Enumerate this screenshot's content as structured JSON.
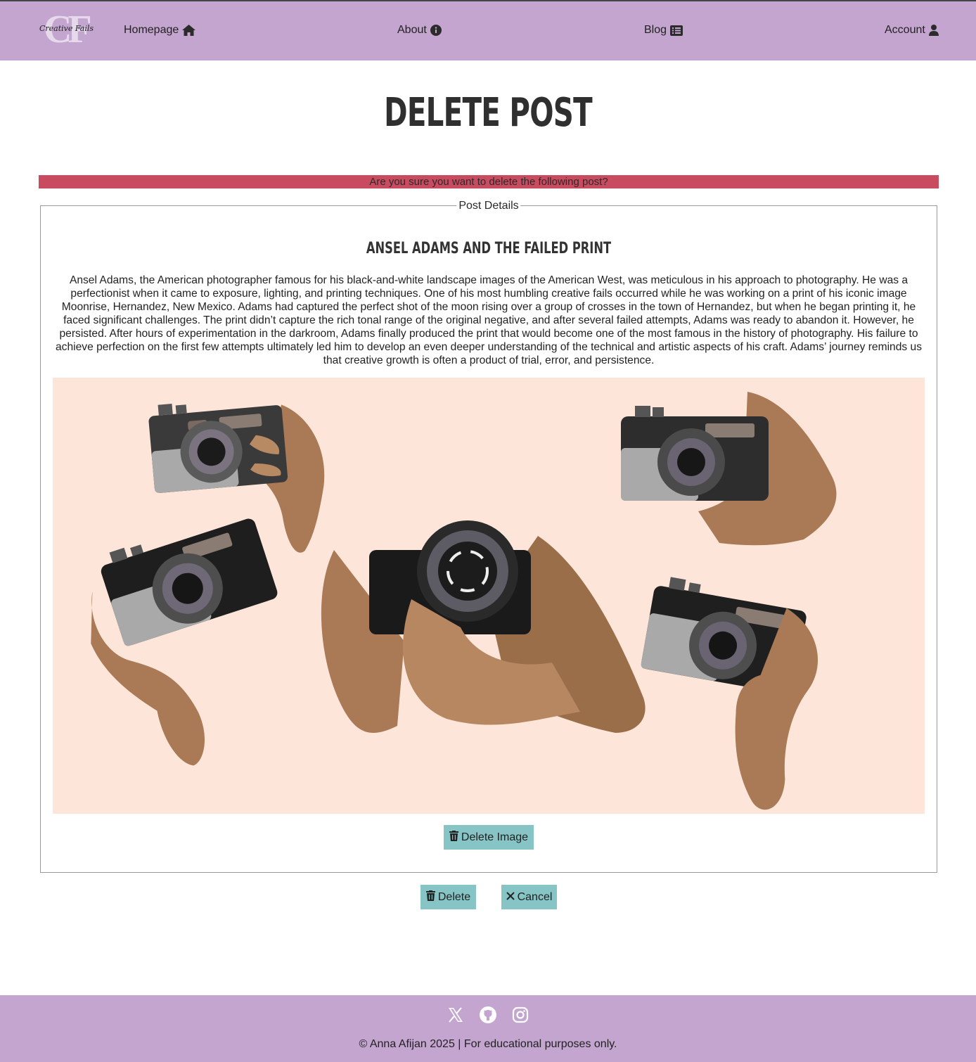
{
  "nav": {
    "logo_monogram": "CF",
    "logo_script": "Creative Fails",
    "links": [
      {
        "label": "Homepage",
        "icon": "home-icon"
      },
      {
        "label": "About",
        "icon": "info-circle-icon"
      },
      {
        "label": "Blog",
        "icon": "list-alt-icon"
      },
      {
        "label": "Account",
        "icon": "user-icon"
      }
    ]
  },
  "page": {
    "title": "DELETE POST",
    "warning": "Are you sure you want to delete the following post?"
  },
  "post": {
    "legend": "Post Details",
    "title": "ANSEL ADAMS AND THE FAILED PRINT",
    "body": "Ansel Adams, the American photographer famous for his black-and-white landscape images of the American West, was meticulous in his approach to photography. He was a perfectionist when it came to exposure, lighting, and printing techniques. One of his most humbling creative fails occurred while he was working on a print of his iconic image Moonrise, Hernandez, New Mexico. Adams had captured the perfect shot of the moon rising over a group of crosses in the town of Hernandez, but when he began printing it, he faced significant challenges. The print didn’t capture the rich tonal range of the original negative, and after several failed attempts, Adams was ready to abandon it. However, he persisted. After hours of experimentation in the darkroom, Adams finally produced the print that would become one of the most famous in the history of photography. His failure to achieve perfection on the first few attempts ultimately led him to develop an even deeper understanding of the technical and artistic aspects of his craft. Adams’ journey reminds us that creative growth is often a product of trial, error, and persistence.",
    "image_icon": "hands-holding-cameras-illustration",
    "delete_image_label": "Delete Image"
  },
  "actions": {
    "delete_label": "Delete",
    "cancel_label": "Cancel"
  },
  "footer": {
    "social": [
      "x-twitter-icon",
      "github-icon",
      "instagram-icon"
    ],
    "copyright": "© Anna Afijan 2025 | For educational purposes only."
  },
  "colors": {
    "nav_bg": "#c3a5cf",
    "warning_bg": "#c84b5f",
    "button_bg": "#86c4c5",
    "image_bg": "#fde6d9"
  }
}
